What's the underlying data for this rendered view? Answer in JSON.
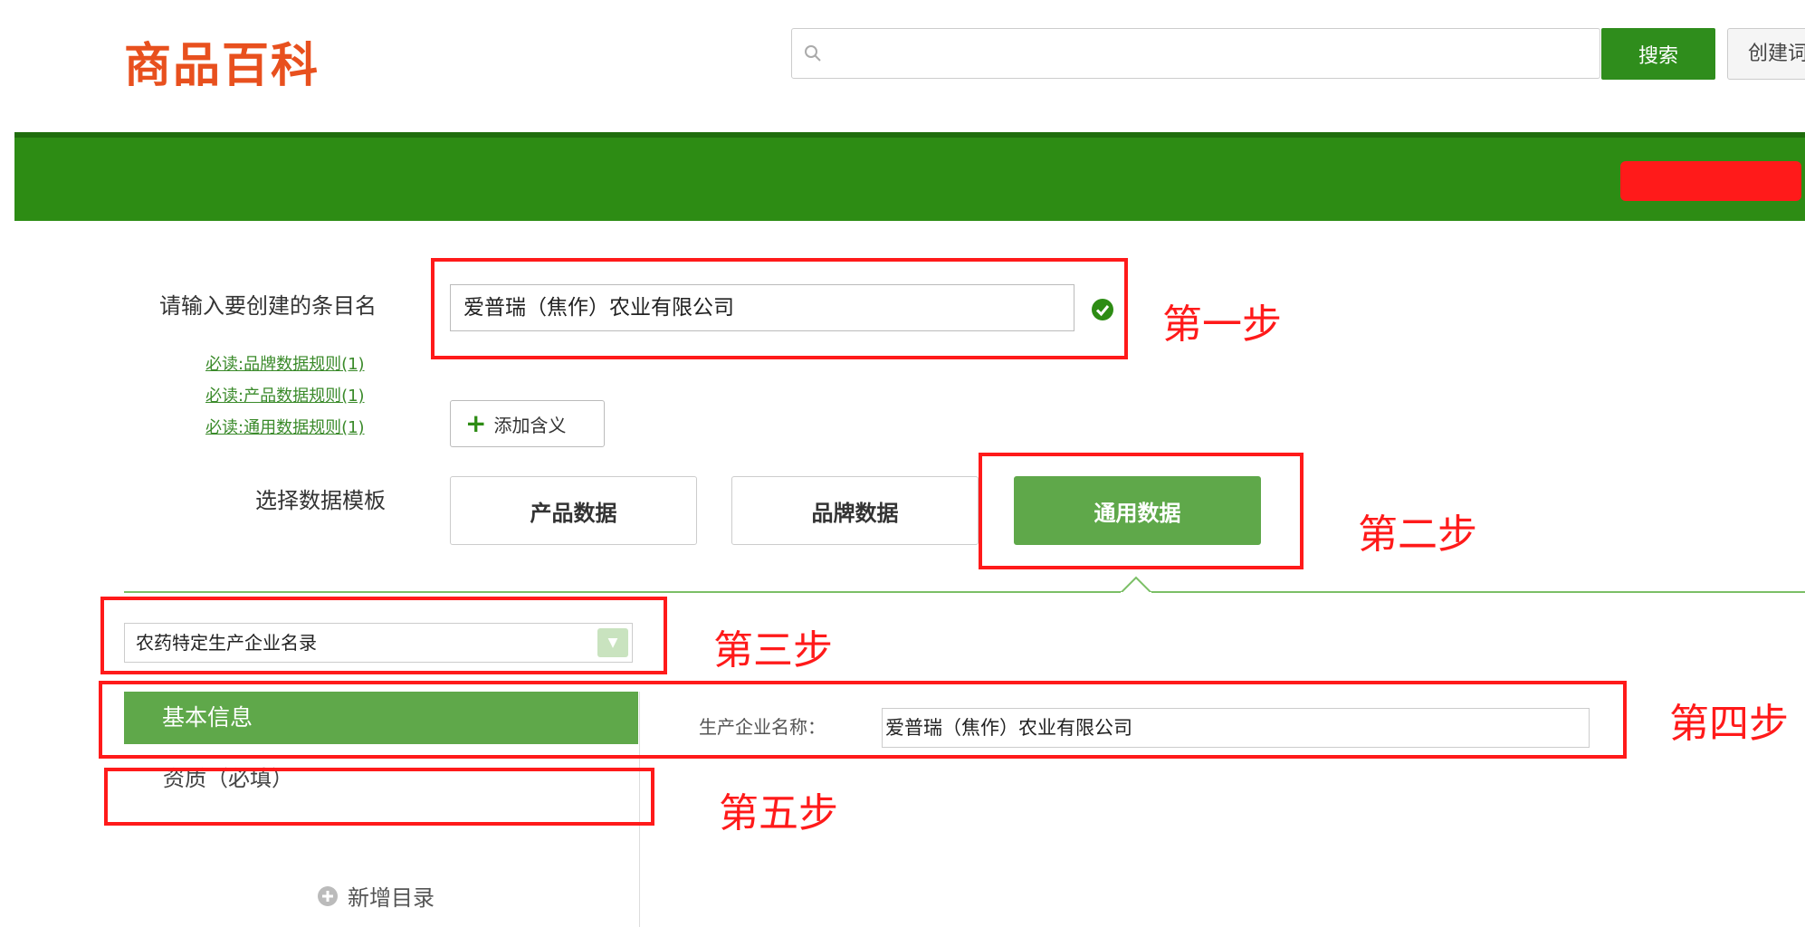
{
  "header": {
    "logo": "商品百科",
    "search_placeholder": "",
    "search_button": "搜索",
    "create_button": "创建词条"
  },
  "form": {
    "entry_name_label": "请输入要创建的条目名",
    "entry_name_value": "爱普瑞（焦作）农业有限公司",
    "rule_links": [
      "必读:品牌数据规则(1)",
      "必读:产品数据规则(1)",
      "必读:通用数据规则(1)"
    ],
    "add_meaning": "添加含义",
    "template_label": "选择数据模板",
    "templates": [
      "产品数据",
      "品牌数据",
      "通用数据"
    ],
    "active_template": "通用数据"
  },
  "sidebar": {
    "category_select": "农药特定生产企业名录",
    "items": [
      "基本信息",
      "资质（必填）"
    ],
    "active_item": "基本信息",
    "new_directory": "新增目录"
  },
  "main": {
    "field_label": "生产企业名称：",
    "field_value": "爱普瑞（焦作）农业有限公司"
  },
  "annotations": {
    "step1": "第一步",
    "step2": "第二步",
    "step3": "第三步",
    "step4": "第四步",
    "step5": "第五步"
  },
  "colors": {
    "brand_orange": "#e8501e",
    "header_green": "#2d8c14",
    "active_green": "#5fa84a",
    "annotation_red": "#ff1a1a"
  }
}
